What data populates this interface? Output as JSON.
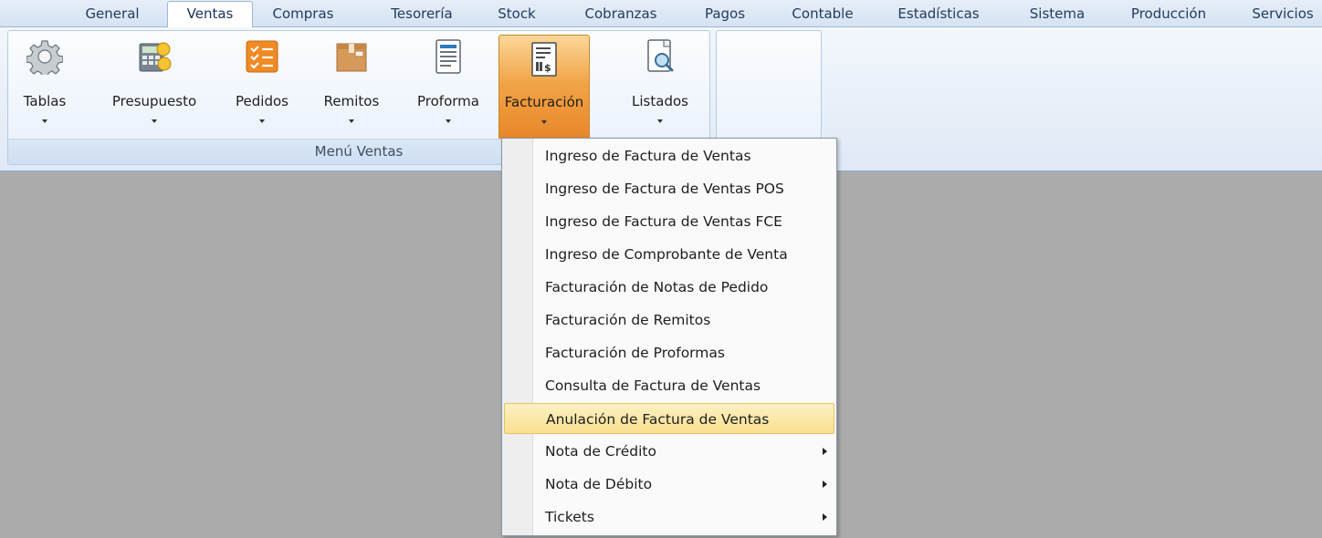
{
  "tabs": [
    {
      "label": "General",
      "active": false
    },
    {
      "label": "Ventas",
      "active": true
    },
    {
      "label": "Compras",
      "active": false
    },
    {
      "label": "Tesorería",
      "active": false
    },
    {
      "label": "Stock",
      "active": false
    },
    {
      "label": "Cobranzas",
      "active": false
    },
    {
      "label": "Pagos",
      "active": false
    },
    {
      "label": "Contable",
      "active": false
    },
    {
      "label": "Estadísticas",
      "active": false
    },
    {
      "label": "Sistema",
      "active": false
    },
    {
      "label": "Producción",
      "active": false
    },
    {
      "label": "Servicios",
      "active": false
    }
  ],
  "ribbon": {
    "group_caption": "Menú Ventas",
    "buttons": [
      {
        "label": "Tablas",
        "icon": "gear-icon"
      },
      {
        "label": "Presupuesto",
        "icon": "calculator-coins-icon"
      },
      {
        "label": "Pedidos",
        "icon": "checklist-icon"
      },
      {
        "label": "Remitos",
        "icon": "box-icon"
      },
      {
        "label": "Proforma",
        "icon": "document-icon"
      },
      {
        "label": "Facturación",
        "icon": "invoice-icon",
        "pressed": true
      },
      {
        "label": "Listados",
        "icon": "document-search-icon"
      }
    ]
  },
  "menu": {
    "items": [
      {
        "label": "Ingreso de Factura de Ventas",
        "submenu": false
      },
      {
        "label": "Ingreso de Factura de Ventas POS",
        "submenu": false
      },
      {
        "label": "Ingreso de Factura de Ventas FCE",
        "submenu": false
      },
      {
        "label": "Ingreso de Comprobante de Venta",
        "submenu": false
      },
      {
        "label": "Facturación de Notas de Pedido",
        "submenu": false
      },
      {
        "label": "Facturación de Remitos",
        "submenu": false
      },
      {
        "label": "Facturación de Proformas",
        "submenu": false
      },
      {
        "label": "Consulta de Factura de Ventas",
        "submenu": false
      },
      {
        "label": "Anulación de Factura de Ventas",
        "submenu": false,
        "highlighted": true
      },
      {
        "label": "Nota de Crédito",
        "submenu": true
      },
      {
        "label": "Nota de Débito",
        "submenu": true
      },
      {
        "label": "Tickets",
        "submenu": true
      }
    ]
  },
  "colors": {
    "pressed_accent": "#f1a547",
    "highlight": "#fbe08e",
    "workspace": "#ababab"
  }
}
